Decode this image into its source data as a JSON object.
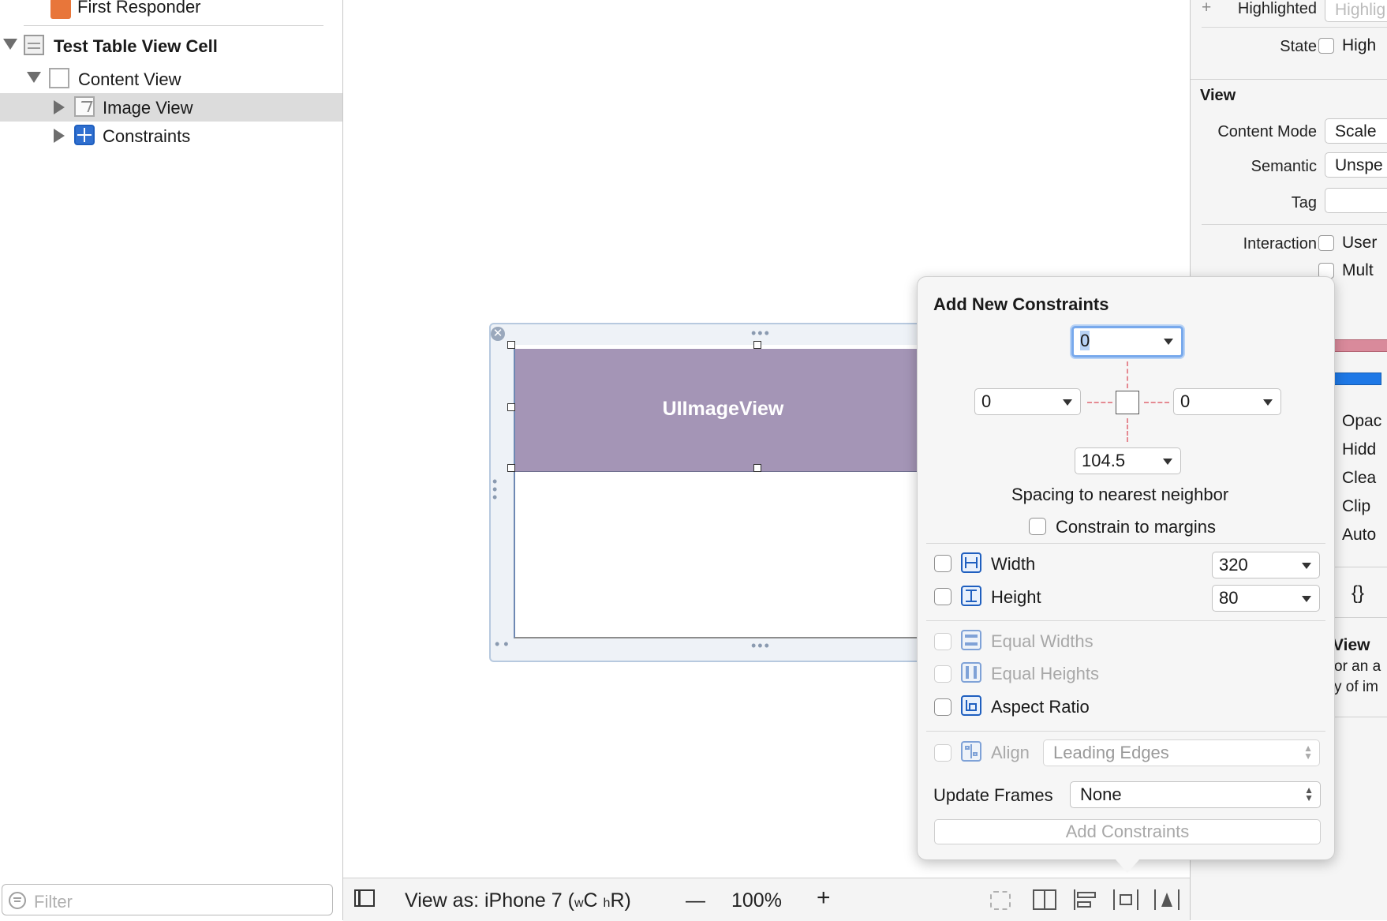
{
  "outline": {
    "items": [
      {
        "label": "First Responder"
      },
      {
        "label": "Test Table View Cell"
      },
      {
        "label": "Content View"
      },
      {
        "label": "Image View"
      },
      {
        "label": "Constraints"
      }
    ],
    "filter_placeholder": "Filter"
  },
  "canvas": {
    "image_view_caption": "UIImageView"
  },
  "bottom_bar": {
    "view_as": "View as: iPhone 7 (",
    "w_size": "w",
    "w_class": "C",
    "h_size": "h",
    "h_class": "R",
    "close_paren": ")",
    "zoom_minus": "—",
    "zoom": "100%",
    "zoom_plus": "+"
  },
  "inspector": {
    "highlighted_label": "Highlighted",
    "highlighted_value": "Highlig",
    "state_label": "State",
    "state_checkbox": "High",
    "section_view": "View",
    "content_mode_label": "Content Mode",
    "content_mode_value": "Scale",
    "semantic_label": "Semantic",
    "semantic_value": "Unspe",
    "tag_label": "Tag",
    "interaction_label": "Interaction",
    "interaction_user": "User",
    "interaction_mult": "Mult",
    "drawing": [
      "Opac",
      "Hidd",
      "Clea",
      "Clip",
      "Auto"
    ],
    "braces": "{}",
    "help_title": "View",
    "help_line1": "or an a",
    "help_line2": "y of im"
  },
  "popover": {
    "title": "Add New Constraints",
    "top_value": "0",
    "left_value": "0",
    "right_value": "0",
    "bottom_value": "104.5",
    "spacing_caption": "Spacing to nearest neighbor",
    "constrain_margins": "Constrain to margins",
    "width_label": "Width",
    "width_value": "320",
    "height_label": "Height",
    "height_value": "80",
    "equal_widths": "Equal Widths",
    "equal_heights": "Equal Heights",
    "aspect_ratio": "Aspect Ratio",
    "align_label": "Align",
    "align_value": "Leading Edges",
    "update_frames_label": "Update Frames",
    "update_frames_value": "None",
    "add_button": "Add Constraints"
  }
}
